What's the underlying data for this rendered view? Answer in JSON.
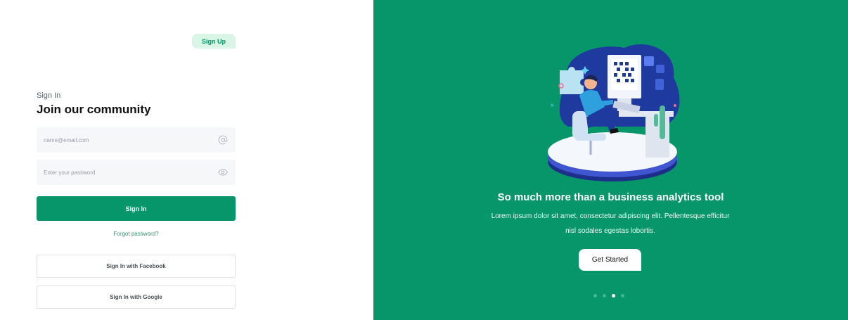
{
  "auth": {
    "signup_label": "Sign Up",
    "eyebrow": "Sign In",
    "heading": "Join our community",
    "email_placeholder": "name@email.com",
    "password_placeholder": "Enter your password",
    "signin_label": "Sign In",
    "forgot_label": "Forgot password?",
    "facebook_label": "Sign In with Facebook",
    "google_label": "Sign In with Google",
    "email_icon": "at-icon",
    "password_icon": "eye-icon"
  },
  "hero": {
    "title": "So much more than a business analytics tool",
    "text": "Lorem ipsum dolor sit amet, consectetur adipiscing elit. Pellentesque efficitur nisl sodales egestas lobortis.",
    "cta_label": "Get Started",
    "slides_total": 4,
    "slide_active": 3
  },
  "colors": {
    "brand": "#079669",
    "brand_light": "#d8f5e6",
    "illustration_blue": "#1e3a9e"
  }
}
